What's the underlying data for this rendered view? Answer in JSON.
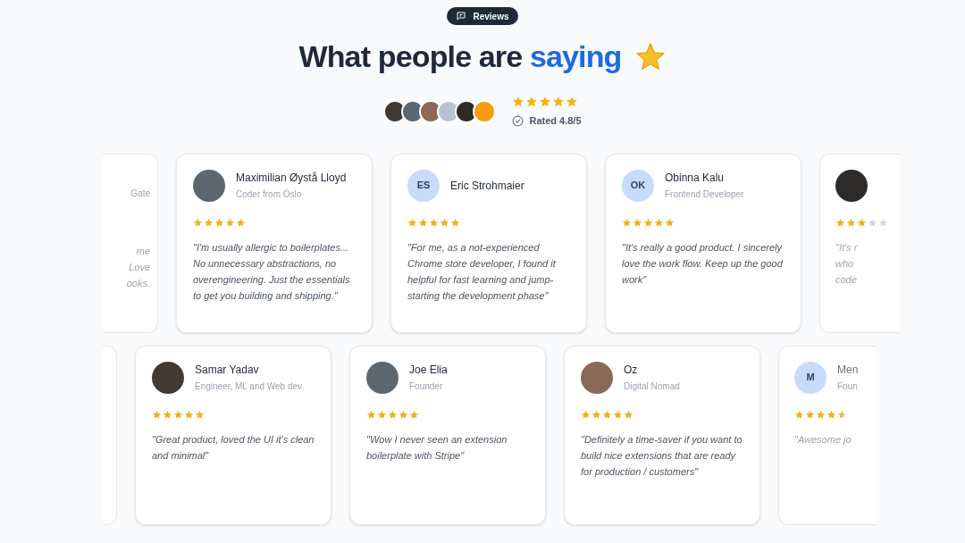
{
  "badge": {
    "label": "Reviews"
  },
  "heading": {
    "text": "What people are",
    "highlight": "saying"
  },
  "summary": {
    "stars": 4.8,
    "rating": "Rated 4.8/5"
  },
  "rows": [
    {
      "cards": [
        {
          "kind": "clipped_left",
          "role": "Gate",
          "fragments": [
            "me",
            "Love",
            "ooks."
          ]
        },
        {
          "kind": "full",
          "avatar": {
            "kind": "photo"
          },
          "name": "Maximilian Øystå Lloyd",
          "role": "Coder from Oslo",
          "stars": 5,
          "quote": "\"I'm usually allergic to boilerplates... No unnecessary abstractions, no overengineering. Just the essentials to get you building and shipping.\""
        },
        {
          "kind": "full",
          "avatar": {
            "kind": "initials",
            "text": "ES"
          },
          "name": "Eric Strohmaier",
          "stars": 5,
          "quote": "\"For me, as a not-experienced Chrome store developer, I found it helpful for fast learning and jump-starting the development phase\""
        },
        {
          "kind": "full",
          "avatar": {
            "kind": "initials",
            "text": "OK"
          },
          "name": "Obinna Kalu",
          "role": "Frontend Developer",
          "stars": 5,
          "quote": "\"It's really a good product. I sincerely love the work flow. Keep up the good work\""
        },
        {
          "kind": "clipped_right",
          "avatar": {
            "kind": "photo"
          },
          "stars": 3,
          "fragments": [
            "\"It's r",
            "who",
            "code"
          ]
        }
      ]
    },
    {
      "cards": [
        {
          "kind": "clipped_left"
        },
        {
          "kind": "full",
          "avatar": {
            "kind": "photo"
          },
          "name": "Samar Yadav",
          "role": "Engineer, ML and Web dev",
          "stars": 5,
          "quote": "\"Great product, loved the UI it's clean and minimal\""
        },
        {
          "kind": "full",
          "avatar": {
            "kind": "photo"
          },
          "name": "Joe Elia",
          "role": "Founder",
          "stars": 5,
          "quote": "\"Wow I never seen an extension boilerplate with Stripe\""
        },
        {
          "kind": "full",
          "avatar": {
            "kind": "photo"
          },
          "name": "Oz",
          "role": "Digital Nomad",
          "stars": 5,
          "quote": "\"Definitely a time-saver if you want to build nice extensions that are ready for production / customers\""
        },
        {
          "kind": "clipped_right",
          "avatar": {
            "kind": "initials",
            "text": "M"
          },
          "name": "Men",
          "role": "Foun",
          "stars": 4.5,
          "fragments": [
            "\"Awesome jo"
          ]
        }
      ]
    }
  ]
}
